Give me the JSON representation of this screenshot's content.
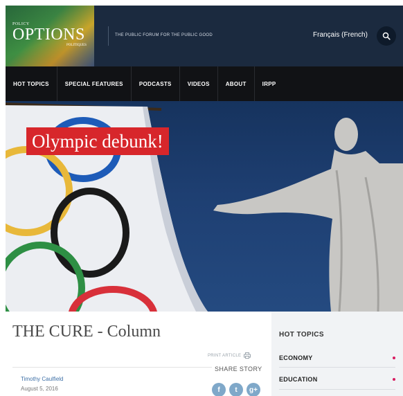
{
  "header": {
    "logo_top": "POLICY",
    "logo_main": "OPTIONS",
    "logo_sub": "POLITIQUES",
    "tagline": "THE PUBLIC FORUM FOR THE PUBLIC GOOD",
    "language_link": "Français (French)",
    "search_icon": "search-icon"
  },
  "nav": {
    "items": [
      "HOT TOPICS",
      "SPECIAL FEATURES",
      "PODCASTS",
      "VIDEOS",
      "ABOUT",
      "IRPP"
    ]
  },
  "hero": {
    "label": "Olympic debunk!"
  },
  "article": {
    "title": "THE CURE - Column",
    "print_label": "PRINT ARTICLE",
    "share_label": "SHARE STORY",
    "author": "Timothy Caulfield",
    "date": "August 5, 2016",
    "share_icons": [
      "f",
      "t",
      "g+"
    ]
  },
  "sidebar": {
    "title": "HOT TOPICS",
    "items": [
      "ECONOMY",
      "EDUCATION"
    ]
  },
  "colors": {
    "header_bg": "#1b2a3f",
    "nav_bg": "#111215",
    "label_red": "#d7262b",
    "accent_pink": "#d81b60"
  }
}
